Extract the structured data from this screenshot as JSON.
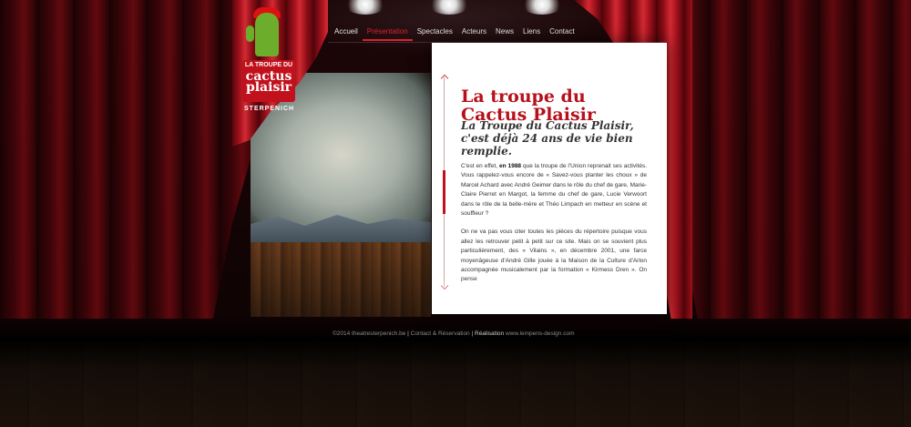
{
  "site": {
    "logo": {
      "top_line": "LA TROUPE DU",
      "name": "cactus plaisir",
      "town": "STERPENICH"
    },
    "nav": [
      {
        "label": "Accueil",
        "active": false
      },
      {
        "label": "Présentation",
        "active": true
      },
      {
        "label": "Spectacles",
        "active": false
      },
      {
        "label": "Acteurs",
        "active": false
      },
      {
        "label": "News",
        "active": false
      },
      {
        "label": "Liens",
        "active": false
      },
      {
        "label": "Contact",
        "active": false
      }
    ]
  },
  "content": {
    "title": "La troupe du Cactus Plaisir",
    "subtitle": "La Troupe du Cactus Plaisir, c'est déjà 24 ans de vie bien remplie.",
    "p1_before": "C'est en effet, ",
    "p1_bold": "en 1988",
    "p1_after": " que la troupe de l'Union reprenait ses activités. Vous rappelez-vous encore de « Savez-vous planter les choux » de Marcel Achard avec André Geimer dans le rôle du chef de gare, Marie-Claire Pierret en Margot, la femme du chef de gare, Lucie Verwoort dans le rôle de la belle-mère et Théo Limpach en metteur en scène et souffleur ?",
    "p2": "On ne va pas vous citer toutes les pièces du répertoire puisque vous allez les retrouver petit à petit sur ce site. Mais on se souvient plus particulièrement, des « Vilains », en décembre 2001, une farce moyenâgeuse d'André Gille jouée à la Maison de la Culture d'Arlon accompagnée musicalement par la formation « Kirmess Dren ». On pense"
  },
  "footer": {
    "copyright": "©2014 theatresterpenich.be",
    "contact": "Contact & Réservation",
    "realisation_label": "Réalisation",
    "realisation_url": "www.lempens-design.com"
  },
  "colors": {
    "accent": "#b8101b",
    "nav_active": "#d7232f"
  }
}
